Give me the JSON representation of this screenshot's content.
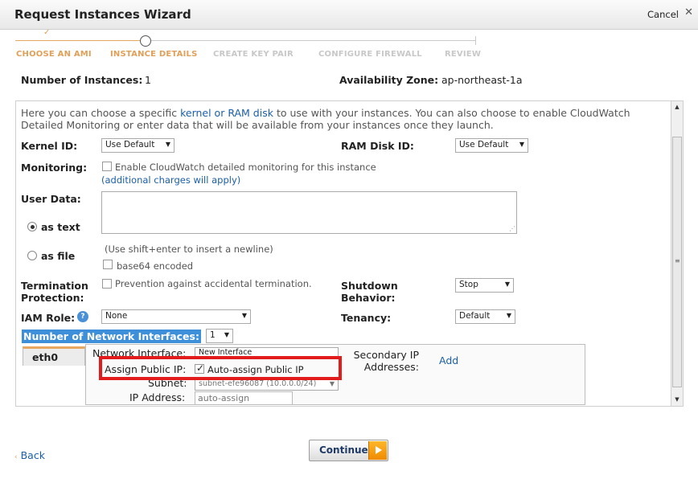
{
  "window": {
    "title": "Request Instances Wizard",
    "cancel_label": "Cancel"
  },
  "steps": [
    {
      "label": "CHOOSE AN AMI",
      "state": "done"
    },
    {
      "label": "INSTANCE DETAILS",
      "state": "active"
    },
    {
      "label": "CREATE KEY PAIR",
      "state": "pending"
    },
    {
      "label": "CONFIGURE FIREWALL",
      "state": "pending"
    },
    {
      "label": "REVIEW",
      "state": "pending"
    }
  ],
  "summary": {
    "num_instances_label": "Number of Instances:",
    "num_instances_value": "1",
    "az_label": "Availability Zone:",
    "az_value": "ap-northeast-1a"
  },
  "intro": {
    "part1": "Here you can choose a specific ",
    "link": "kernel or RAM disk",
    "part2": " to use with your instances. You can also choose to enable CloudWatch",
    "line2": "Detailed Monitoring or enter data that will be available from your instances once they launch."
  },
  "kernel": {
    "label": "Kernel ID:",
    "value": "Use Default"
  },
  "ramdisk": {
    "label": "RAM Disk ID:",
    "value": "Use Default"
  },
  "monitoring": {
    "label": "Monitoring:",
    "checkbox_label": "Enable CloudWatch detailed monitoring for this instance",
    "charges_link": "(additional charges will apply)",
    "checked": false
  },
  "user_data": {
    "label": "User Data:",
    "as_text": "as text",
    "as_file": "as file",
    "hint": "(Use shift+enter to insert a newline)",
    "base64_label": "base64 encoded",
    "value": ""
  },
  "termination": {
    "label_line1": "Termination",
    "label_line2": "Protection:",
    "checkbox_label": "Prevention against accidental termination."
  },
  "shutdown": {
    "label_line1": "Shutdown",
    "label_line2": "Behavior:",
    "value": "Stop"
  },
  "iam": {
    "label": "IAM Role:",
    "help_icon": "?",
    "value": "None"
  },
  "tenancy": {
    "label": "Tenancy:",
    "value": "Default"
  },
  "network": {
    "label": "Number of Network Interfaces:",
    "count": "1",
    "tab_label": "eth0",
    "interface_label": "Network Interface:",
    "interface_value": "New Interface",
    "assign_ip_label": "Assign Public IP:",
    "assign_ip_checkbox": "Auto-assign Public IP",
    "assign_ip_checked": true,
    "subnet_label": "Subnet:",
    "subnet_value": "subnet-efe96087 (10.0.0.0/24)",
    "ip_label": "IP Address:",
    "ip_placeholder": "auto-assign",
    "secondary_label_line1": "Secondary IP",
    "secondary_label_line2": "Addresses:",
    "add_link": "Add"
  },
  "footer": {
    "back_label": "Back",
    "continue_label": "Continue"
  },
  "colors": {
    "accent": "#e0a05a",
    "link": "#1a5faa",
    "highlight": "#e21c1c",
    "selection": "#3d8fd9"
  }
}
